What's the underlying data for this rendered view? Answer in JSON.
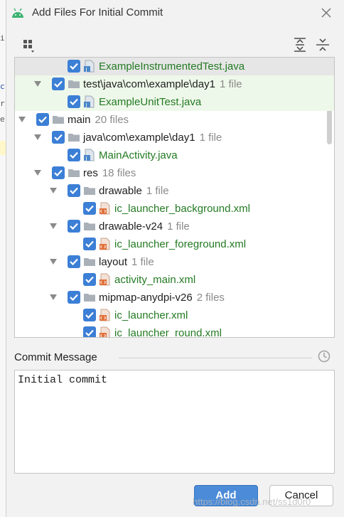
{
  "dialog": {
    "title": "Add Files For Initial Commit",
    "title_icon": "android-icon",
    "close_icon": "close-icon"
  },
  "colors": {
    "checkbox": "#3c7fd6",
    "added_file": "#237a23",
    "count": "#8a8a8a",
    "primary_button": "#4b8bd8",
    "new_row_bg": "#eef8ea",
    "selected_row_bg": "#e6e6e6"
  },
  "toolbar": {
    "group_by_icon": "group-by-icon",
    "expand_all_icon": "expand-all-icon",
    "collapse_all_icon": "collapse-all-icon"
  },
  "tree": {
    "rows": [
      {
        "name": "ExampleInstrumentedTest.java",
        "count": "",
        "icon": "java-file-icon",
        "added": true,
        "expanded": null
      },
      {
        "name": "test\\java\\com\\example\\day1",
        "count": "1 file",
        "icon": "folder-icon",
        "added": false,
        "expanded": true
      },
      {
        "name": "ExampleUnitTest.java",
        "count": "",
        "icon": "java-file-icon",
        "added": true,
        "expanded": null
      },
      {
        "name": "main",
        "count": "20 files",
        "icon": "folder-icon",
        "added": false,
        "expanded": true
      },
      {
        "name": "java\\com\\example\\day1",
        "count": "1 file",
        "icon": "folder-icon",
        "added": false,
        "expanded": true
      },
      {
        "name": "MainActivity.java",
        "count": "",
        "icon": "java-file-icon",
        "added": true,
        "expanded": null
      },
      {
        "name": "res",
        "count": "18 files",
        "icon": "folder-icon",
        "added": false,
        "expanded": true
      },
      {
        "name": "drawable",
        "count": "1 file",
        "icon": "folder-icon",
        "added": false,
        "expanded": true
      },
      {
        "name": "ic_launcher_background.xml",
        "count": "",
        "icon": "xml-file-icon",
        "added": true,
        "expanded": null
      },
      {
        "name": "drawable-v24",
        "count": "1 file",
        "icon": "folder-icon",
        "added": false,
        "expanded": true
      },
      {
        "name": "ic_launcher_foreground.xml",
        "count": "",
        "icon": "xml-file-icon",
        "added": true,
        "expanded": null
      },
      {
        "name": "layout",
        "count": "1 file",
        "icon": "folder-icon",
        "added": false,
        "expanded": true
      },
      {
        "name": "activity_main.xml",
        "count": "",
        "icon": "xml-file-icon",
        "added": true,
        "expanded": null
      },
      {
        "name": "mipmap-anydpi-v26",
        "count": "2 files",
        "icon": "folder-icon",
        "added": false,
        "expanded": true
      },
      {
        "name": "ic_launcher.xml",
        "count": "",
        "icon": "xml-file-icon",
        "added": true,
        "expanded": null
      },
      {
        "name": "ic_launcher_round.xml",
        "count": "",
        "icon": "xml-file-icon",
        "added": true,
        "expanded": null
      }
    ]
  },
  "commit": {
    "label": "Commit Message",
    "value": "Initial commit",
    "history_icon": "history-icon"
  },
  "buttons": {
    "add": "Add",
    "cancel": "Cancel"
  },
  "watermark": "https://blog.csdn.net/ss1d0r0"
}
